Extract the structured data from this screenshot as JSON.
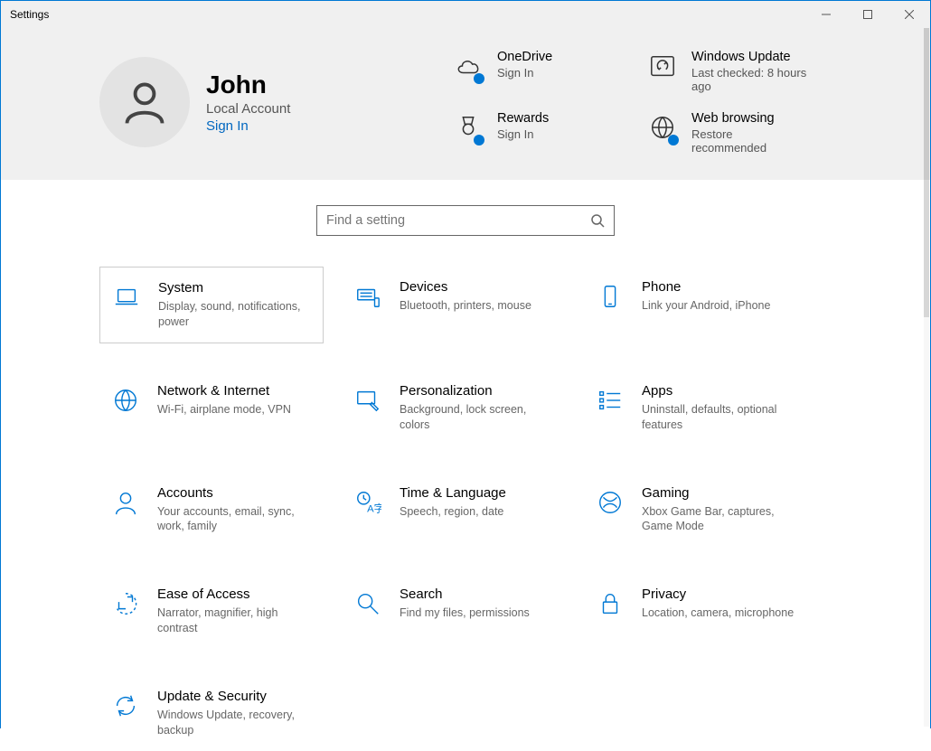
{
  "window": {
    "title": "Settings"
  },
  "profile": {
    "name": "John",
    "account_type": "Local Account",
    "signin_label": "Sign In"
  },
  "tiles": {
    "onedrive": {
      "title": "OneDrive",
      "sub": "Sign In"
    },
    "update": {
      "title": "Windows Update",
      "sub": "Last checked: 8 hours ago"
    },
    "rewards": {
      "title": "Rewards",
      "sub": "Sign In"
    },
    "web": {
      "title": "Web browsing",
      "sub": "Restore recommended"
    }
  },
  "search": {
    "placeholder": "Find a setting"
  },
  "categories": [
    {
      "id": "system",
      "title": "System",
      "sub": "Display, sound, notifications, power",
      "selected": true
    },
    {
      "id": "devices",
      "title": "Devices",
      "sub": "Bluetooth, printers, mouse"
    },
    {
      "id": "phone",
      "title": "Phone",
      "sub": "Link your Android, iPhone"
    },
    {
      "id": "network",
      "title": "Network & Internet",
      "sub": "Wi-Fi, airplane mode, VPN"
    },
    {
      "id": "personal",
      "title": "Personalization",
      "sub": "Background, lock screen, colors"
    },
    {
      "id": "apps",
      "title": "Apps",
      "sub": "Uninstall, defaults, optional features"
    },
    {
      "id": "accounts",
      "title": "Accounts",
      "sub": "Your accounts, email, sync, work, family"
    },
    {
      "id": "time",
      "title": "Time & Language",
      "sub": "Speech, region, date"
    },
    {
      "id": "gaming",
      "title": "Gaming",
      "sub": "Xbox Game Bar, captures, Game Mode"
    },
    {
      "id": "ease",
      "title": "Ease of Access",
      "sub": "Narrator, magnifier, high contrast"
    },
    {
      "id": "search",
      "title": "Search",
      "sub": "Find my files, permissions"
    },
    {
      "id": "privacy",
      "title": "Privacy",
      "sub": "Location, camera, microphone"
    },
    {
      "id": "update",
      "title": "Update & Security",
      "sub": "Windows Update, recovery, backup"
    }
  ]
}
